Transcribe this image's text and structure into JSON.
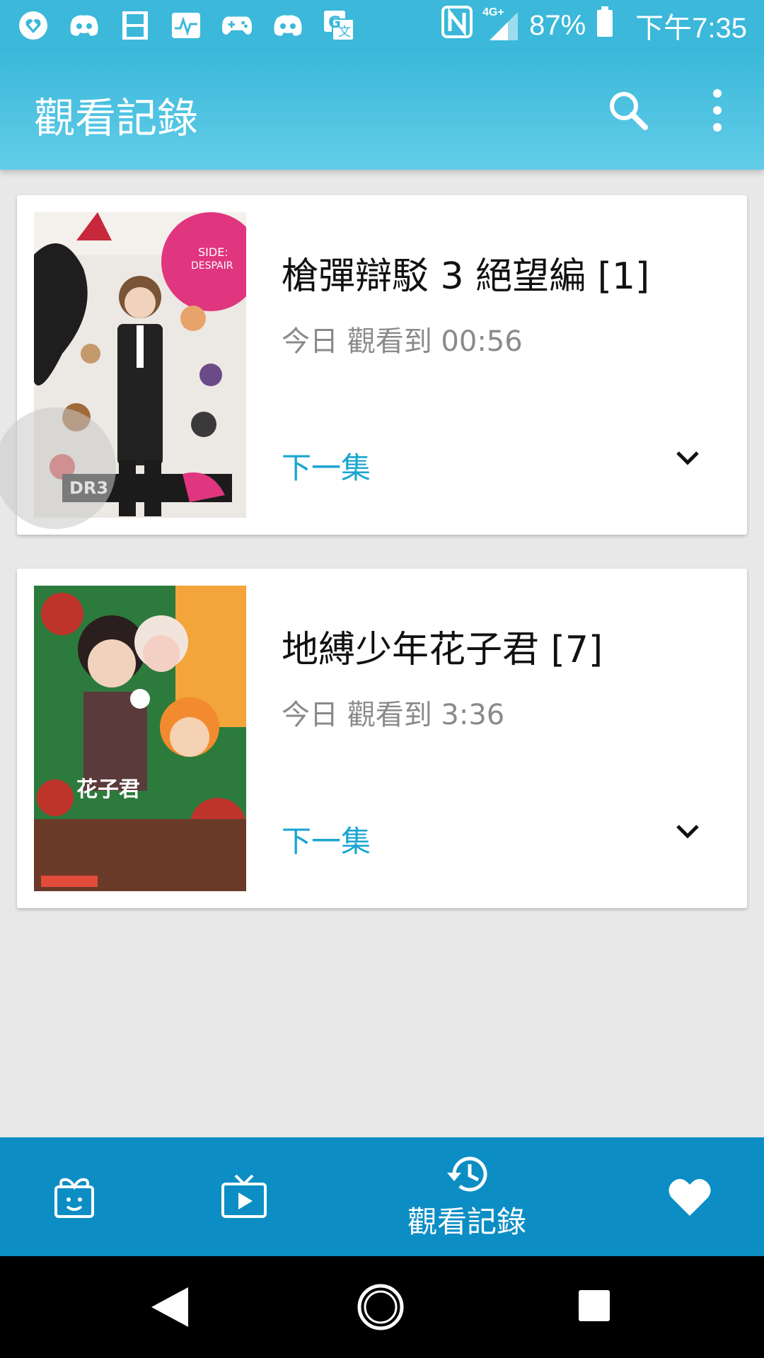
{
  "status_bar": {
    "icons": [
      "heart-diamond-icon",
      "discord-icon",
      "film-icon",
      "activity-icon",
      "gamepad-icon",
      "discord-icon",
      "translate-icon"
    ],
    "nfc": "N",
    "network": "4G+",
    "battery": "87%",
    "time": "下午7:35"
  },
  "app_bar": {
    "title": "觀看記錄"
  },
  "history": [
    {
      "title": "槍彈辯駁 3 絕望編 [1]",
      "subtitle": "今日 觀看到 00:56",
      "next_label": "下一集",
      "thumb_colors": [
        "#e8e4df",
        "#e0357f",
        "#1a1a1a"
      ]
    },
    {
      "title": "地縛少年花子君 [7]",
      "subtitle": "今日 觀看到 3:36",
      "next_label": "下一集",
      "thumb_colors": [
        "#2d7a3d",
        "#c0352b",
        "#f3a43b"
      ]
    }
  ],
  "bottom_nav": {
    "items": [
      {
        "icon": "gift-face-icon",
        "label": ""
      },
      {
        "icon": "tv-play-icon",
        "label": ""
      },
      {
        "icon": "history-icon",
        "label": "觀看記錄"
      },
      {
        "icon": "heart-icon",
        "label": ""
      }
    ]
  },
  "colors": {
    "primary": "#3bb8da",
    "nav": "#0c8ec4",
    "accent": "#1ba5d0"
  }
}
